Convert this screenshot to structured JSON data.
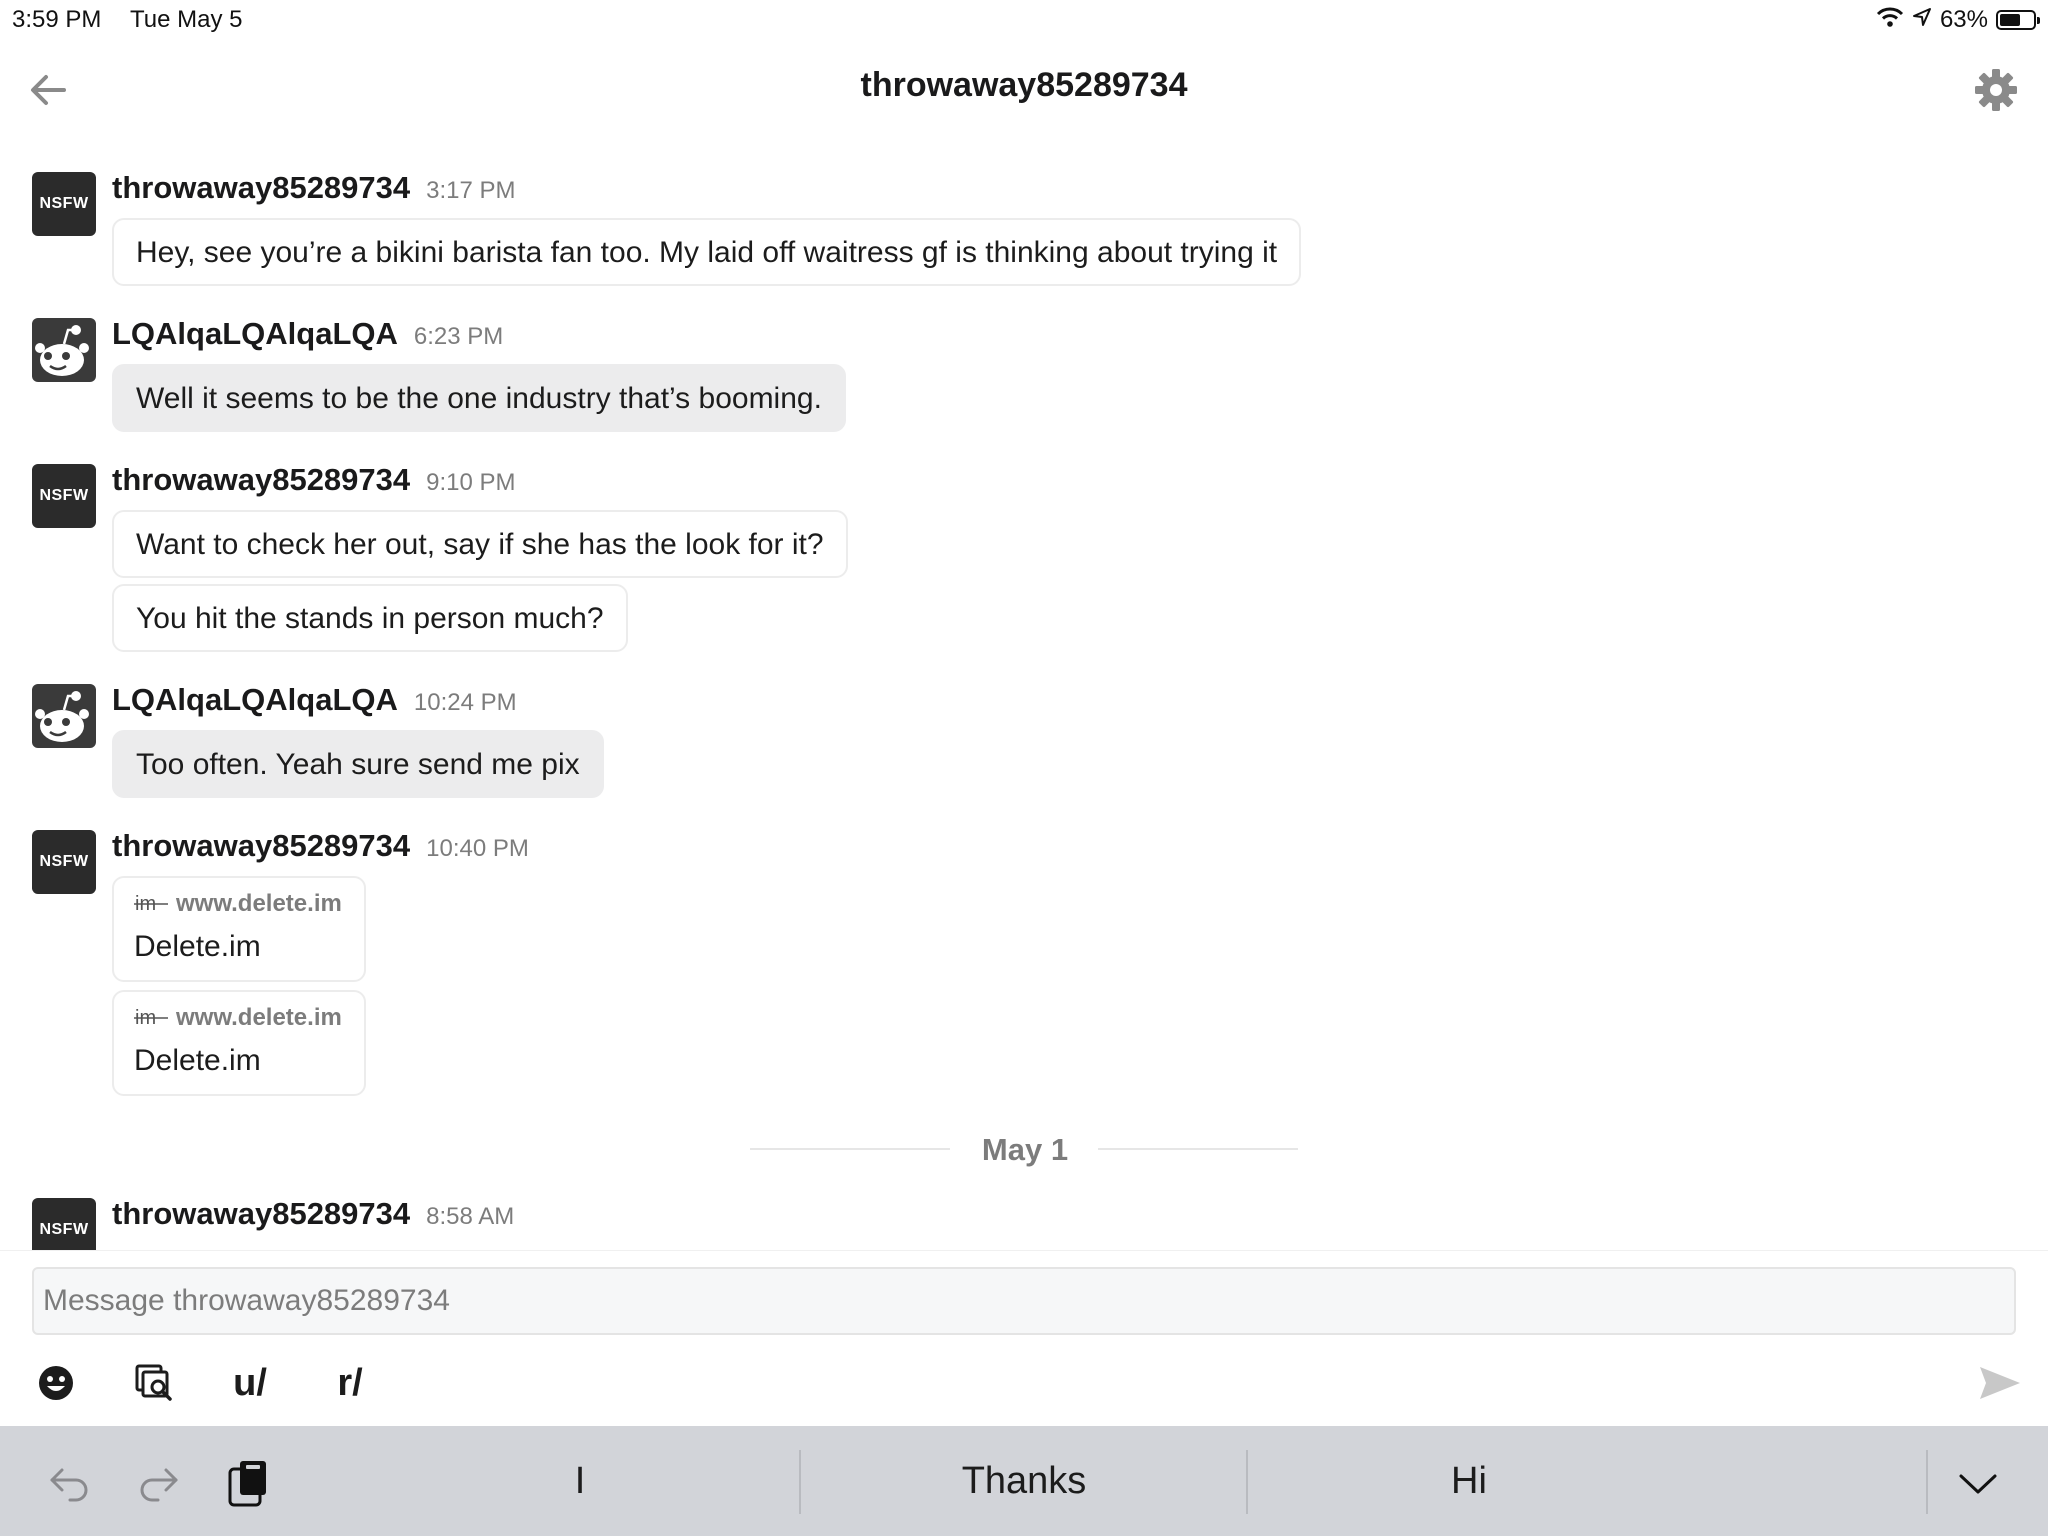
{
  "status_bar": {
    "time": "3:59 PM",
    "date": "Tue May 5",
    "battery_text": "63%",
    "battery_level": 0.63,
    "icons": [
      "wifi-icon",
      "location-arrow-icon",
      "battery-icon"
    ]
  },
  "header": {
    "title": "throwaway85289734",
    "back_icon": "arrow-left-icon",
    "settings_icon": "gear-icon"
  },
  "messages": [
    {
      "username": "throwaway85289734",
      "time": "3:17 PM",
      "avatar": "NSFW",
      "bubbles": [
        "Hey, see you’re a bikini barista fan too. My laid off waitress gf is thinking about trying it"
      ]
    },
    {
      "username": "LQAlqaLQAlqaLQA",
      "time": "6:23 PM",
      "avatar": "snoo-avatar-icon",
      "bubbles": [
        "Well it seems to be the one industry that’s booming."
      ]
    },
    {
      "username": "throwaway85289734",
      "time": "9:10 PM",
      "avatar": "NSFW",
      "bubbles": [
        "Want to check her out, say if she has the look for it?",
        "You hit the stands in person much?"
      ]
    },
    {
      "username": "LQAlqaLQAlqaLQA",
      "time": "10:24 PM",
      "avatar": "snoo-avatar-icon",
      "bubbles": [
        "Too often. Yeah sure send me pix"
      ]
    },
    {
      "username": "throwaway85289734",
      "time": "10:40 PM",
      "avatar": "NSFW",
      "links": [
        {
          "domain": "www.delete.im",
          "title": "Delete.im",
          "favicon": "im"
        },
        {
          "domain": "www.delete.im",
          "title": "Delete.im",
          "favicon": "im"
        }
      ]
    },
    {
      "username": "throwaway85289734",
      "time": "8:58 AM",
      "avatar": "NSFW"
    }
  ],
  "date_separator": "May 1",
  "composer": {
    "placeholder": "Message throwaway85289734",
    "value": "",
    "tools": [
      "emoji-icon",
      "image-search-icon",
      "u/",
      "r/"
    ],
    "send_icon": "send-icon"
  },
  "keyboard_bar": {
    "suggestions": [
      "I",
      "Thanks",
      "Hi"
    ],
    "icons": [
      "undo-icon",
      "redo-icon",
      "clipboard-icon",
      "chevron-down-icon"
    ]
  },
  "colors": {
    "bubble_incoming": "#ececed",
    "bubble_outgoing_border": "#ececec",
    "muted_text": "#7c7c7c",
    "keyboard_bar": "#d2d4d9"
  }
}
